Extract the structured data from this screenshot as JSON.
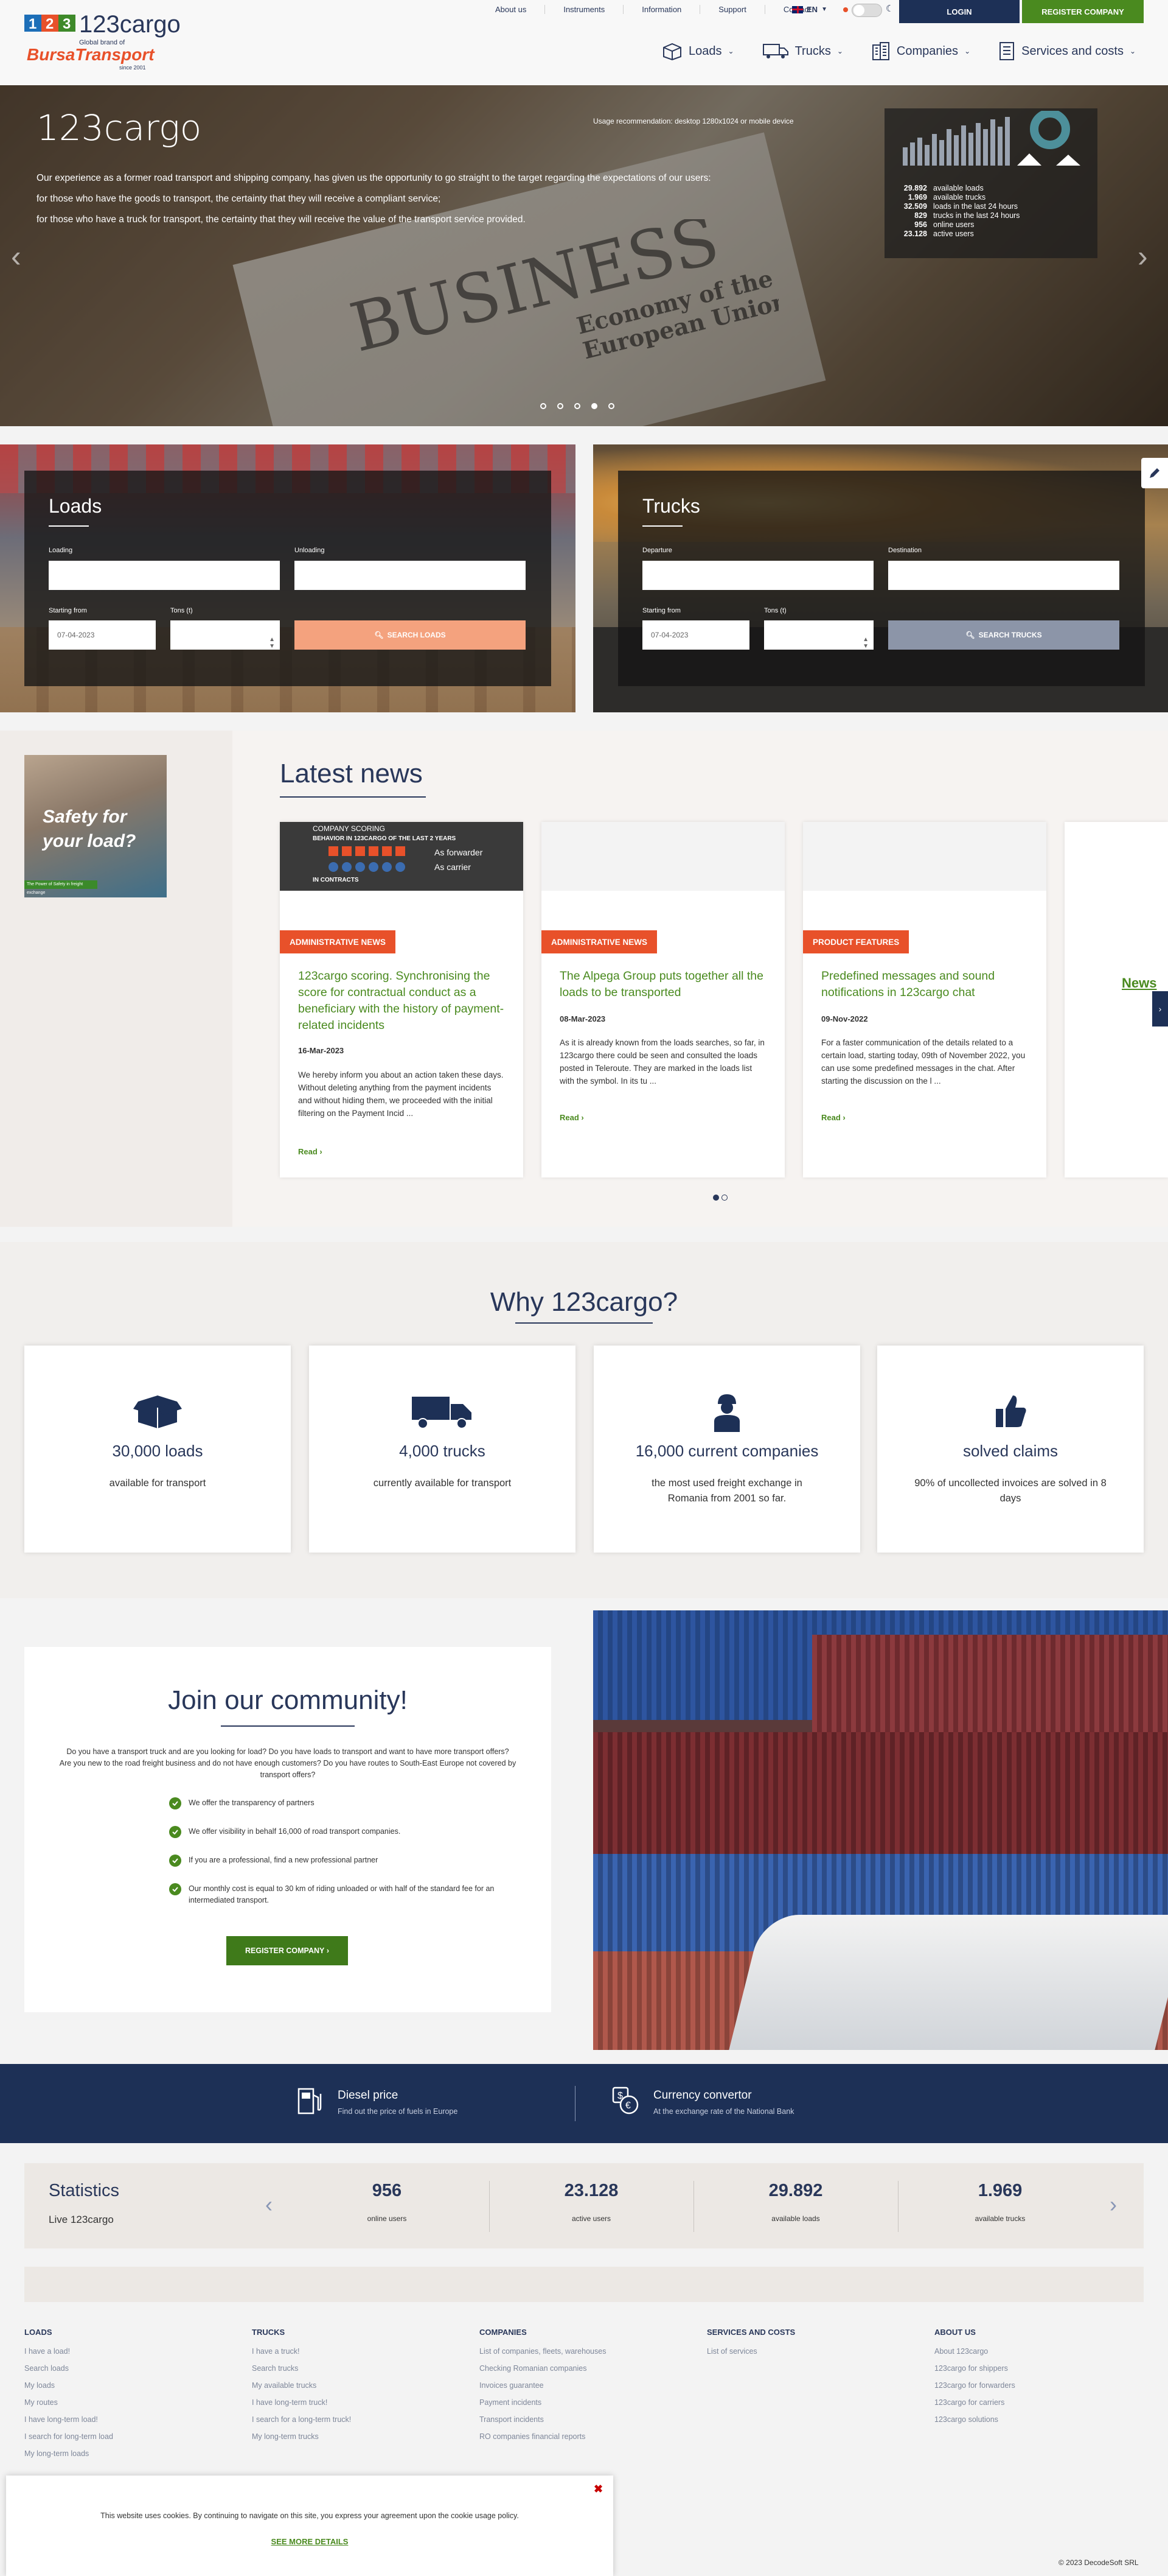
{
  "header": {
    "logo_text": "123cargo",
    "logo_sub": "Global brand of",
    "logo_brand": "BursaTransport",
    "logo_since": "since 2001",
    "topnav": [
      "About us",
      "Instruments",
      "Information",
      "Support",
      "Contact"
    ],
    "lang": "EN",
    "login": "LOGIN",
    "register": "REGISTER COMPANY",
    "mainnav": [
      "Loads",
      "Trucks",
      "Companies",
      "Services and costs"
    ]
  },
  "hero": {
    "title": "123cargo",
    "usage": "Usage recommendation: desktop 1280x1024 or mobile device",
    "lines": [
      "Our experience as a former road transport and shipping company, has given us the opportunity to go straight to the target regarding the expectations of our users:",
      "for those who have the goods to transport, the certainty that they will receive a compliant service;",
      "for those who have a truck for transport, the certainty that they will receive the value of the transport service provided."
    ],
    "stats": [
      {
        "n": "29.892",
        "l": "available loads"
      },
      {
        "n": "1.969",
        "l": "available trucks"
      },
      {
        "n": "32.509",
        "l": "loads in the last 24 hours"
      },
      {
        "n": "829",
        "l": "trucks in the last 24 hours"
      },
      {
        "n": "956",
        "l": "online users"
      },
      {
        "n": "23.128",
        "l": "active users"
      }
    ],
    "slide_active": 4
  },
  "loads": {
    "title": "Loads",
    "loading": "Loading",
    "unloading": "Unloading",
    "start": "Starting from",
    "tons": "Tons (t)",
    "date": "07-04-2023",
    "button": "SEARCH LOADS"
  },
  "trucks": {
    "title": "Trucks",
    "departure": "Departure",
    "destination": "Destination",
    "start": "Starting from",
    "tons": "Tons (t)",
    "date": "07-04-2023",
    "button": "SEARCH TRUCKS"
  },
  "promo": {
    "title": "Safety for your load?",
    "bar": "The Power of Safety in freight exchange"
  },
  "news": {
    "title": "Latest news",
    "cards": [
      {
        "tag": "ADMINISTRATIVE NEWS",
        "title": "123cargo scoring. Synchronising the score for contractual conduct as a beneficiary with the history of payment-related incidents",
        "date": "16-Mar-2023",
        "body": "We hereby inform you about an action taken these days.   Without deleting anything from the payment incidents and without hiding them, we proceeded with the initial filtering on the Payment Incid ...",
        "read": "Read",
        "img_title": "COMPANY SCORING",
        "img_sub": "BEHAVIOR IN 123CARGO OF THE LAST 2 YEARS",
        "img_fw": "As forwarder",
        "img_ca": "As carrier",
        "img_ct": "IN CONTRACTS"
      },
      {
        "tag": "ADMINISTRATIVE NEWS",
        "title": "The Alpega Group puts together all the loads to be transported",
        "date": "08-Mar-2023",
        "body": "As it is already known from the loads searches, so far, in 123cargo there could be seen and consulted the loads posted in Teleroute. They are marked in the loads list with the  symbol. In its tu ...",
        "read": "Read"
      },
      {
        "tag": "PRODUCT FEATURES",
        "title": "Predefined messages and sound notifications in 123cargo chat",
        "date": "09-Nov-2022",
        "body": "For a faster communication of the details related to a certain load, starting today, 09th of November 2022, you can use some predefined messages in the chat. After starting the discussion on the l ...",
        "read": "Read"
      }
    ],
    "partial": "News"
  },
  "why": {
    "title": "Why 123cargo?",
    "cards": [
      {
        "big": "30,000 loads",
        "sm": "available for transport",
        "icon": "box-icon"
      },
      {
        "big": "4,000 trucks",
        "sm": "currently available for transport",
        "icon": "truck-icon"
      },
      {
        "big": "16,000 current companies",
        "sm": "the most used freight exchange in Romania from 2001 so far.",
        "icon": "worker-icon"
      },
      {
        "big": "solved claims",
        "sm": "90% of uncollected invoices are solved in 8 days",
        "icon": "thumbs-up-icon"
      }
    ]
  },
  "community": {
    "title": "Join our community!",
    "intro1": "Do you have a transport truck and are you looking for load? Do you have loads to transport and want to have more transport offers?",
    "intro2": "Are you new to the road freight business and do not have enough customers? Do you have routes to South-East Europe not covered by transport offers?",
    "checks": [
      "We offer the transparency of partners",
      "We offer visibility in behalf 16,000 of road transport companies.",
      "If you are a professional, find a new professional partner",
      "Our monthly cost is equal to 30 km of riding unloaded or with half of the standard fee for an intermediated transport."
    ],
    "button": "REGISTER COMPANY"
  },
  "tools": [
    {
      "t1": "Diesel price",
      "t2": "Find out the price of fuels in Europe"
    },
    {
      "t1": "Currency convertor",
      "t2": "At the exchange rate of the National Bank"
    }
  ],
  "stats": {
    "title": "Statistics",
    "sub": "Live 123cargo",
    "items": [
      {
        "n": "956",
        "l": "online users"
      },
      {
        "n": "23.128",
        "l": "active users"
      },
      {
        "n": "29.892",
        "l": "available loads"
      },
      {
        "n": "1.969",
        "l": "available trucks"
      }
    ]
  },
  "footer": {
    "cols": [
      {
        "h": "LOADS",
        "items": [
          "I have a load!",
          "Search loads",
          "My loads",
          "My routes",
          "I have long-term load!",
          "I search for long-term load",
          "My long-term loads"
        ]
      },
      {
        "h": "TRUCKS",
        "items": [
          "I have a truck!",
          "Search trucks",
          "My available trucks",
          "I have long-term truck!",
          "I search for a long-term truck!",
          "My long-term trucks"
        ]
      },
      {
        "h": "COMPANIES",
        "items": [
          "List of companies, fleets, warehouses",
          "Checking Romanian companies",
          "Invoices guarantee",
          "Payment incidents",
          "Transport incidents",
          "RO companies financial reports"
        ]
      },
      {
        "h": "SERVICES AND COSTS",
        "items": [
          "List of services"
        ]
      },
      {
        "h": "ABOUT US",
        "items": [
          "About 123cargo",
          "123cargo for shippers",
          "123cargo for forwarders",
          "123cargo for carriers",
          "123cargo solutions"
        ]
      }
    ],
    "copyright": "© 2023 DecodeSoft SRL"
  },
  "cookie": {
    "text": "This website uses cookies. By continuing to navigate on this site, you express your agreement upon the cookie usage policy.",
    "link": "SEE MORE DETAILS",
    "close": "✖"
  },
  "colors": {
    "navy": "#1d3056",
    "green": "#4a8a1f",
    "orange": "#e8512a"
  }
}
